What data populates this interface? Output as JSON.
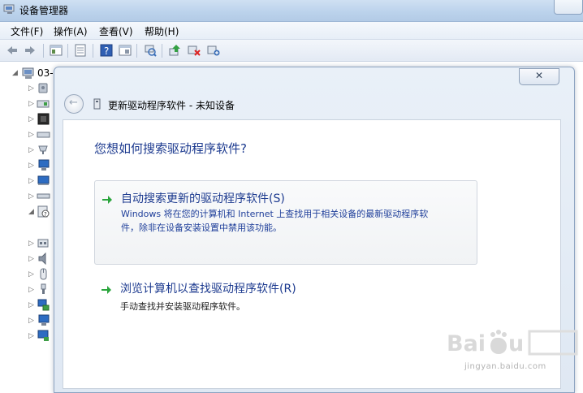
{
  "window": {
    "title": "设备管理器"
  },
  "menu": {
    "items": [
      "文件(F)",
      "操作(A)",
      "查看(V)",
      "帮助(H)"
    ]
  },
  "toolbar": {
    "icons": [
      "back-icon",
      "forward-icon",
      "tree-view-icon",
      "properties-icon",
      "help-icon",
      "console-icon",
      "scan-hardware-icon",
      "update-driver-icon",
      "disable-icon",
      "uninstall-icon"
    ]
  },
  "tree": {
    "root_label": "03-",
    "items": [
      "disk-drive",
      "monitor-adapter",
      "processor",
      "cdrom",
      "keyboard",
      "computer",
      "display",
      "ide-controller",
      "unknown-device",
      "port",
      "sound",
      "mouse",
      "usb",
      "network",
      "monitor2",
      "system-device"
    ]
  },
  "dialog": {
    "close_glyph": "✕",
    "header_title": "更新驱动程序软件 - 未知设备",
    "question": "您想如何搜索驱动程序软件?",
    "option_auto": {
      "title": "自动搜索更新的驱动程序软件(S)",
      "desc_line1": "Windows 将在您的计算机和 Internet 上查找用于相关设备的最新驱动程序软",
      "desc_line2": "件，除非在设备安装设置中禁用该功能。"
    },
    "option_browse": {
      "title": "浏览计算机以查找驱动程序软件(R)",
      "desc": "手动查找并安装驱动程序软件。"
    }
  },
  "watermark": {
    "site": "jingyan.baidu.com"
  },
  "colors": {
    "link_blue": "#1c3a8f",
    "arrow_green": "#2aa53c",
    "titlebar": "#bcd3ec"
  }
}
